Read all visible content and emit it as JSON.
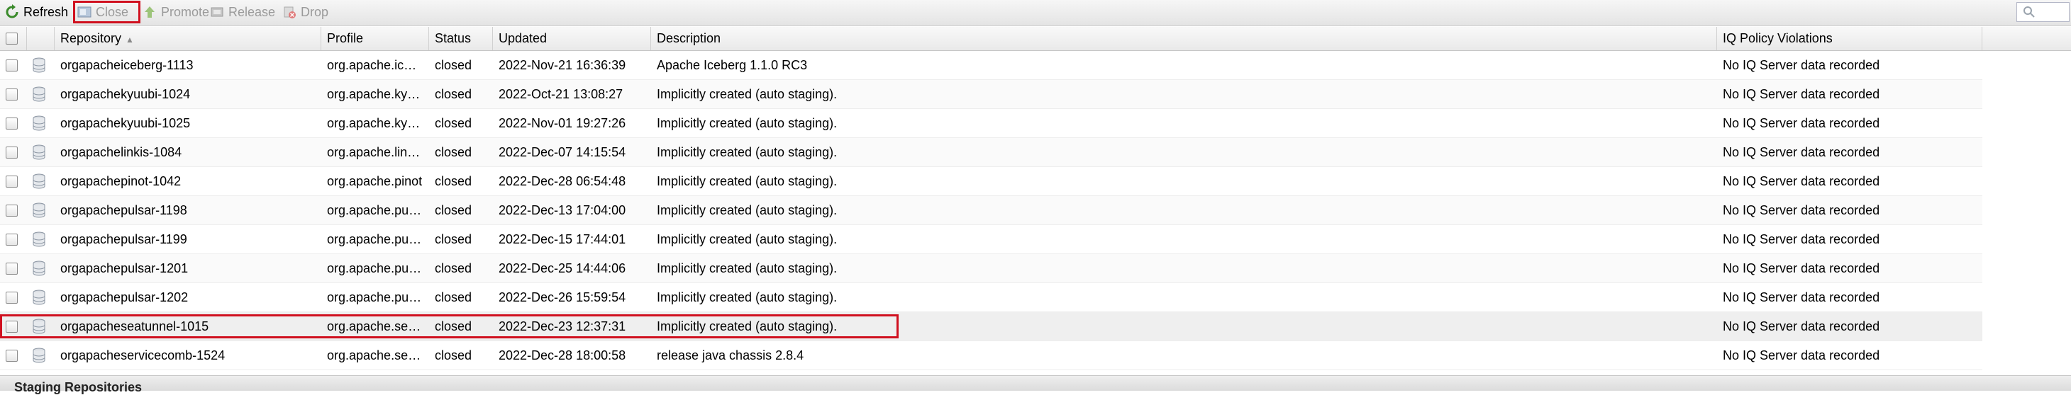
{
  "toolbar": {
    "refresh": "Refresh",
    "close": "Close",
    "promote": "Promote",
    "release": "Release",
    "drop": "Drop"
  },
  "columns": {
    "repository": "Repository",
    "profile": "Profile",
    "status": "Status",
    "updated": "Updated",
    "description": "Description",
    "iq": "IQ Policy Violations"
  },
  "rows": [
    {
      "repository": "orgapacheiceberg-1113",
      "profile": "org.apache.ic…",
      "status": "closed",
      "updated": "2022-Nov-21 16:36:39",
      "description": "Apache Iceberg 1.1.0 RC3",
      "iq": "No IQ Server data recorded"
    },
    {
      "repository": "orgapachekyuubi-1024",
      "profile": "org.apache.ky…",
      "status": "closed",
      "updated": "2022-Oct-21 13:08:27",
      "description": "Implicitly created (auto staging).",
      "iq": "No IQ Server data recorded"
    },
    {
      "repository": "orgapachekyuubi-1025",
      "profile": "org.apache.ky…",
      "status": "closed",
      "updated": "2022-Nov-01 19:27:26",
      "description": "Implicitly created (auto staging).",
      "iq": "No IQ Server data recorded"
    },
    {
      "repository": "orgapachelinkis-1084",
      "profile": "org.apache.lin…",
      "status": "closed",
      "updated": "2022-Dec-07 14:15:54",
      "description": "Implicitly created (auto staging).",
      "iq": "No IQ Server data recorded"
    },
    {
      "repository": "orgapachepinot-1042",
      "profile": "org.apache.pinot",
      "status": "closed",
      "updated": "2022-Dec-28 06:54:48",
      "description": "Implicitly created (auto staging).",
      "iq": "No IQ Server data recorded"
    },
    {
      "repository": "orgapachepulsar-1198",
      "profile": "org.apache.pu…",
      "status": "closed",
      "updated": "2022-Dec-13 17:04:00",
      "description": "Implicitly created (auto staging).",
      "iq": "No IQ Server data recorded"
    },
    {
      "repository": "orgapachepulsar-1199",
      "profile": "org.apache.pu…",
      "status": "closed",
      "updated": "2022-Dec-15 17:44:01",
      "description": "Implicitly created (auto staging).",
      "iq": "No IQ Server data recorded"
    },
    {
      "repository": "orgapachepulsar-1201",
      "profile": "org.apache.pu…",
      "status": "closed",
      "updated": "2022-Dec-25 14:44:06",
      "description": "Implicitly created (auto staging).",
      "iq": "No IQ Server data recorded"
    },
    {
      "repository": "orgapachepulsar-1202",
      "profile": "org.apache.pu…",
      "status": "closed",
      "updated": "2022-Dec-26 15:59:54",
      "description": "Implicitly created (auto staging).",
      "iq": "No IQ Server data recorded"
    },
    {
      "repository": "orgapacheseatunnel-1015",
      "profile": "org.apache.se…",
      "status": "closed",
      "updated": "2022-Dec-23 12:37:31",
      "description": "Implicitly created (auto staging).",
      "iq": "No IQ Server data recorded"
    },
    {
      "repository": "orgapacheservicecomb-1524",
      "profile": "org.apache.se…",
      "status": "closed",
      "updated": "2022-Dec-28 18:00:58",
      "description": "release java chassis 2.8.4",
      "iq": "No IQ Server data recorded"
    }
  ],
  "footer": {
    "title": "Staging Repositories"
  },
  "colors": {
    "highlight": "#d0101f",
    "disabled_text": "#9a9a9a"
  }
}
